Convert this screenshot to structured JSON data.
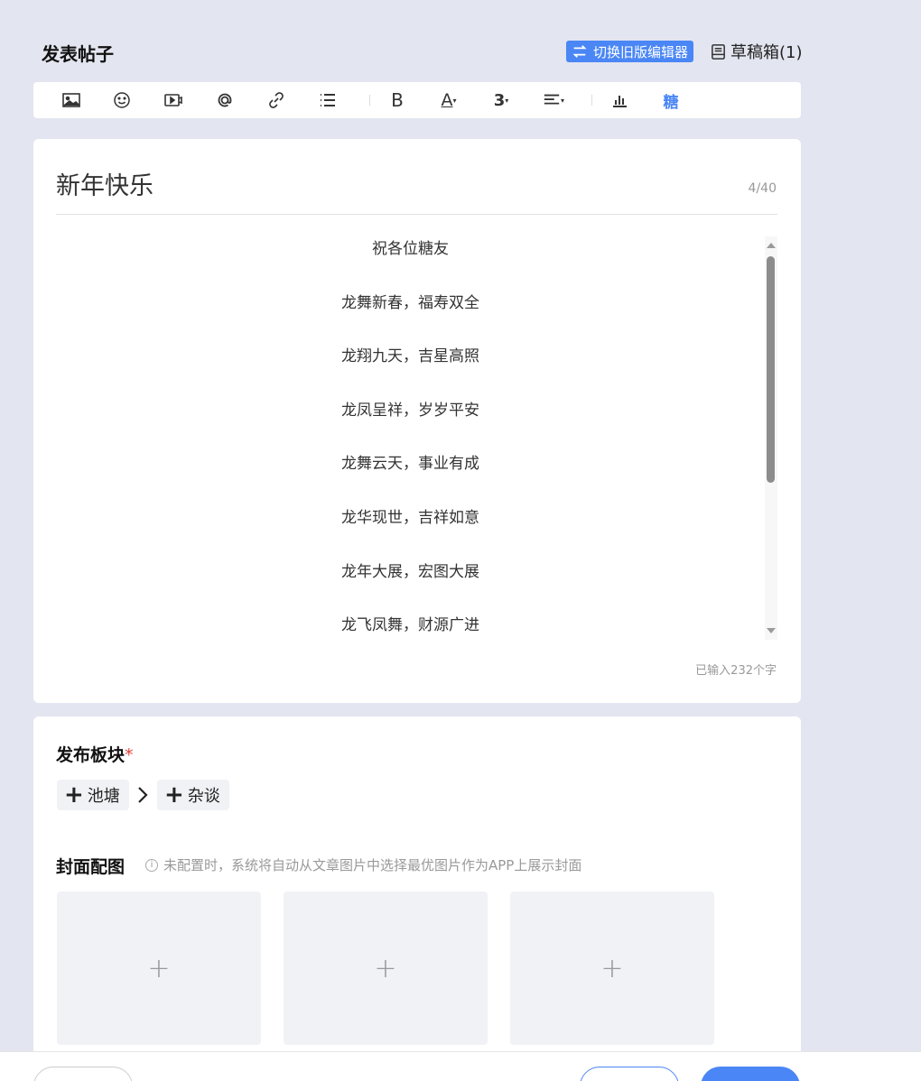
{
  "header": {
    "title": "发表帖子",
    "switch_editor_label": "切换旧版编辑器",
    "drafts_label": "草稿箱(1)"
  },
  "toolbar": {
    "items": [
      "image-icon",
      "emoji-icon",
      "video-icon",
      "at-mention-icon",
      "link-icon",
      "list-icon",
      "bold-icon",
      "font-color-icon",
      "heading-icon",
      "align-icon",
      "chart-icon",
      "sugar-icon"
    ],
    "bold_label": "B",
    "font_color_label": "A",
    "heading_label": "3",
    "sugar_label": "糖",
    "sugar_color": "#4a86f5"
  },
  "editor": {
    "title_value": "新年快乐",
    "title_count": "4/40",
    "body_lines": [
      "祝各位糖友",
      "龙舞新春，福寿双全",
      "龙翔九天，吉星高照",
      "龙凤呈祥，岁岁平安",
      "龙舞云天，事业有成",
      "龙华现世，吉祥如意",
      "龙年大展，宏图大展",
      "龙飞凤舞，财源广进"
    ],
    "char_count": "已输入232个字"
  },
  "publish": {
    "board_label": "发布板块",
    "required_mark": "*",
    "board_primary": "池塘",
    "board_secondary": "杂谈",
    "cover_label": "封面配图",
    "cover_hint": "未配置时，系统将自动从文章图片中选择最优图片作为APP上展示封面",
    "cover_plus": "+"
  },
  "colors": {
    "accent": "#4a86f5",
    "background": "#e3e5f0",
    "required": "#e0443a"
  }
}
